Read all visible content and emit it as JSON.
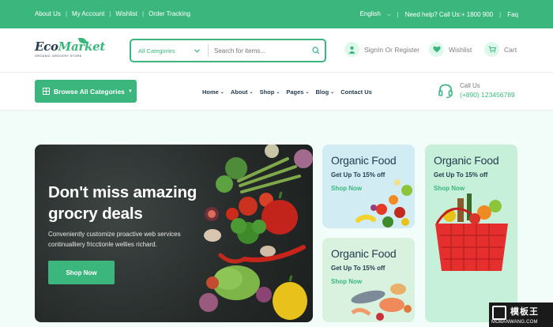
{
  "topbar": {
    "links": [
      "About Us",
      "My Account",
      "Wishlist",
      "Order Tracking"
    ],
    "language": "English",
    "help": "Need help? Call Us:+ 1800 900",
    "faq": "Faq"
  },
  "header": {
    "logo": {
      "name_part1": "Eco",
      "name_part2": "Market",
      "tagline": "ORGANIC GROCERY STORE"
    },
    "search": {
      "category": "All Categories",
      "placeholder": "Search for items..."
    },
    "signin": "SignIn Or Register",
    "wishlist": "Wishlist",
    "cart": "Cart"
  },
  "nav": {
    "browse": "Browse All Categories",
    "menu": [
      "Home",
      "About",
      "Shop",
      "Pages",
      "Blog"
    ],
    "contact": "Contact Us",
    "callus_label": "Call Us",
    "callus_phone": "(+890) 123456789"
  },
  "hero": {
    "title_line1": "Don't miss amazing",
    "title_line2": "grocry deals",
    "desc_line1": "Conveniently customize proactive web services",
    "desc_line2": "continualliery fricctionle wellies richard.",
    "button": "Shop Now"
  },
  "promos": [
    {
      "title": "Organic Food",
      "subtitle": "Get Up To 15% off",
      "link": "Shop Now"
    },
    {
      "title": "Organic Food",
      "subtitle": "Get Up To 15% off",
      "link": "Shop Now"
    },
    {
      "title": "Organic Food",
      "subtitle": "Get Up To 15% off",
      "link": "Shop Now"
    }
  ],
  "watermark": {
    "title": "模板王",
    "url": "MOBANWANG.COM"
  },
  "colors": {
    "brand": "#3bb77e",
    "text": "#253d4e",
    "muted": "#7e7e7e",
    "bg": "#f2fcf8"
  }
}
